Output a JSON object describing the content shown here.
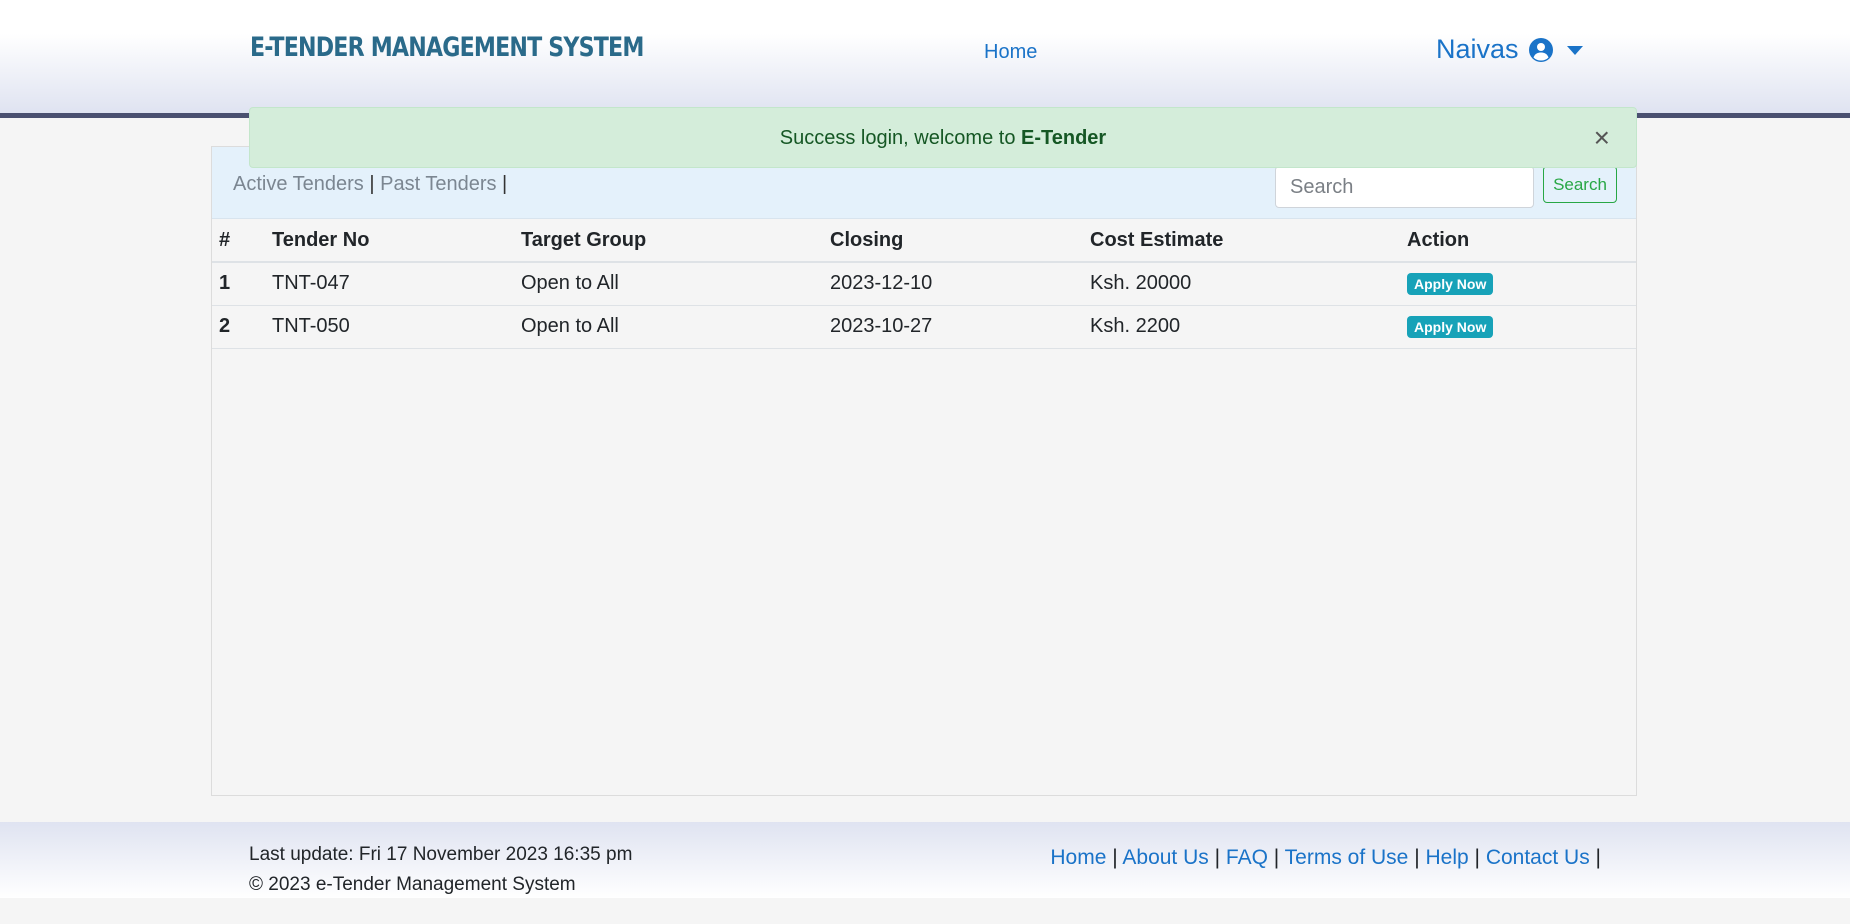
{
  "header": {
    "brand": "E-TENDER MANAGEMENT SYSTEM",
    "nav_home": "Home",
    "user_name": "Naivas"
  },
  "alert": {
    "message": "Success login, welcome to ",
    "emphasis": "E-Tender",
    "close": "×"
  },
  "toolbar": {
    "active_tenders": "Active Tenders",
    "separator": " | ",
    "past_tenders": "Past Tenders",
    "trailing_separator": " |",
    "search_placeholder": "Search",
    "search_button": "Search"
  },
  "table": {
    "headers": [
      "#",
      "Tender No",
      "Target Group",
      "Closing",
      "Cost Estimate",
      "Action"
    ],
    "rows": [
      {
        "index": "1",
        "tender_no": "TNT-047",
        "target_group": "Open to All",
        "closing": "2023-12-10",
        "cost_estimate": "Ksh. 20000",
        "action": "Apply Now"
      },
      {
        "index": "2",
        "tender_no": "TNT-050",
        "target_group": "Open to All",
        "closing": "2023-10-27",
        "cost_estimate": "Ksh. 2200",
        "action": "Apply Now"
      }
    ]
  },
  "footer": {
    "last_update": "Last update: Fri 17 November 2023 16:35 pm",
    "copyright": "© 2023 e-Tender Management System",
    "links": [
      "Home",
      "About Us",
      "FAQ",
      "Terms of Use",
      "Help",
      "Contact Us"
    ],
    "separator": " | ",
    "trailing": " |"
  },
  "colors": {
    "brand": "#2a6a8a",
    "link": "#1a73c8",
    "success_bg": "#d4edda",
    "apply_button": "#17a2b8",
    "search_button": "#28a745"
  },
  "icons": [
    "user-circle-icon",
    "caret-down-icon",
    "close-icon"
  ]
}
